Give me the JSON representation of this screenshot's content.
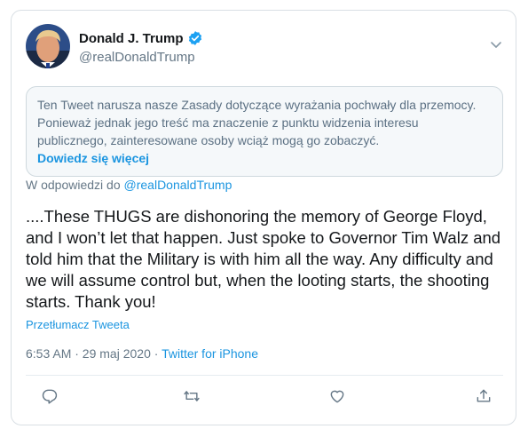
{
  "author": {
    "name": "Donald J. Trump",
    "handle": "@realDonaldTrump"
  },
  "notice": {
    "text": "Ten Tweet narusza nasze Zasady dotyczące wyrażania pochwały dla przemocy. Ponieważ jednak jego treść ma znaczenie z punktu widzenia interesu publicznego, zainteresowane osoby wciąż mogą go zobaczyć.",
    "link": "Dowiedz się więcej"
  },
  "reply": {
    "prefix": "W odpowiedzi do",
    "mention": "@realDonaldTrump"
  },
  "tweet": {
    "text": "....These THUGS are dishonoring the memory of George Floyd, and I won’t let that happen. Just spoke to Governor Tim Walz and told him that the Military is with him all the way. Any difficulty and we will assume control but, when the looting starts, the shooting starts. Thank you!",
    "translate": "Przetłumacz Tweeta"
  },
  "meta": {
    "timestamp": "6:53 AM · 29 maj 2020 ·",
    "source": "Twitter for iPhone"
  },
  "colors": {
    "accent": "#1b95e0",
    "verified": "#1da1f2",
    "muted": "#657786"
  }
}
